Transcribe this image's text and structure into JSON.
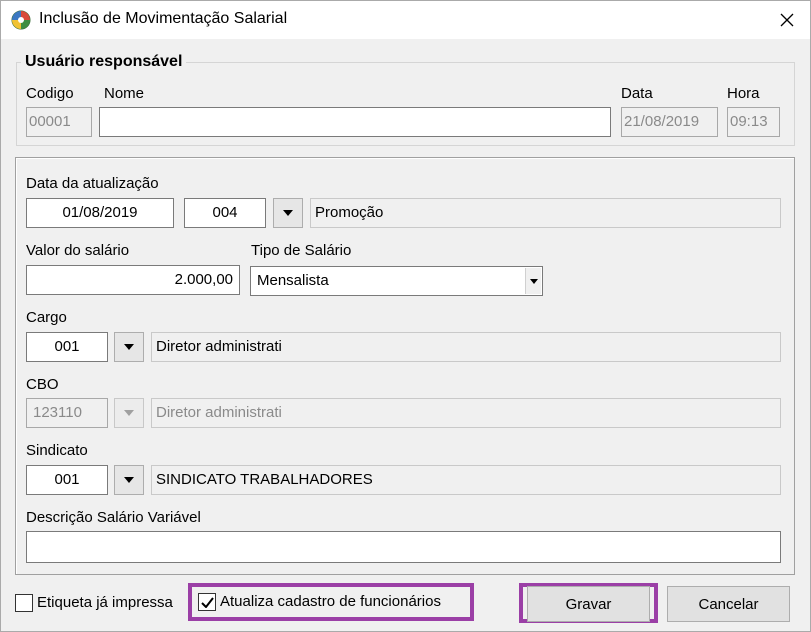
{
  "window": {
    "title": "Inclusão de Movimentação Salarial"
  },
  "responsavel": {
    "group_title": "Usuário responsável",
    "codigo_label": "Codigo",
    "codigo_value": "00001",
    "nome_label": "Nome",
    "nome_value": "",
    "data_label": "Data",
    "data_value": "21/08/2019",
    "hora_label": "Hora",
    "hora_value": "09:13"
  },
  "form": {
    "data_atualizacao_label": "Data da atualização",
    "data_atualizacao_value": "01/08/2019",
    "motivo_code": "004",
    "motivo_desc": "Promoção",
    "valor_label": "Valor do salário",
    "valor_value": "2.000,00",
    "tipo_label": "Tipo de Salário",
    "tipo_value": "Mensalista",
    "cargo_label": "Cargo",
    "cargo_code": "001",
    "cargo_desc": "Diretor administrati",
    "cbo_label": "CBO",
    "cbo_code": "123110",
    "cbo_desc": "Diretor administrati",
    "sindicato_label": "Sindicato",
    "sindicato_code": "001",
    "sindicato_desc": "SINDICATO TRABALHADORES",
    "descricao_label": "Descrição Salário Variável",
    "descricao_value": ""
  },
  "footer": {
    "etiqueta_label": "Etiqueta já impressa",
    "etiqueta_checked": false,
    "atualiza_label": "Atualiza cadastro de funcionários",
    "atualiza_checked": true,
    "gravar_label": "Gravar",
    "cancelar_label": "Cancelar"
  },
  "colors": {
    "highlight": "#9b3fa6"
  },
  "icons": {
    "app": "app-globe-icon",
    "close": "close-icon",
    "dropdown": "dropdown-arrow-icon",
    "check": "checkmark-icon"
  }
}
